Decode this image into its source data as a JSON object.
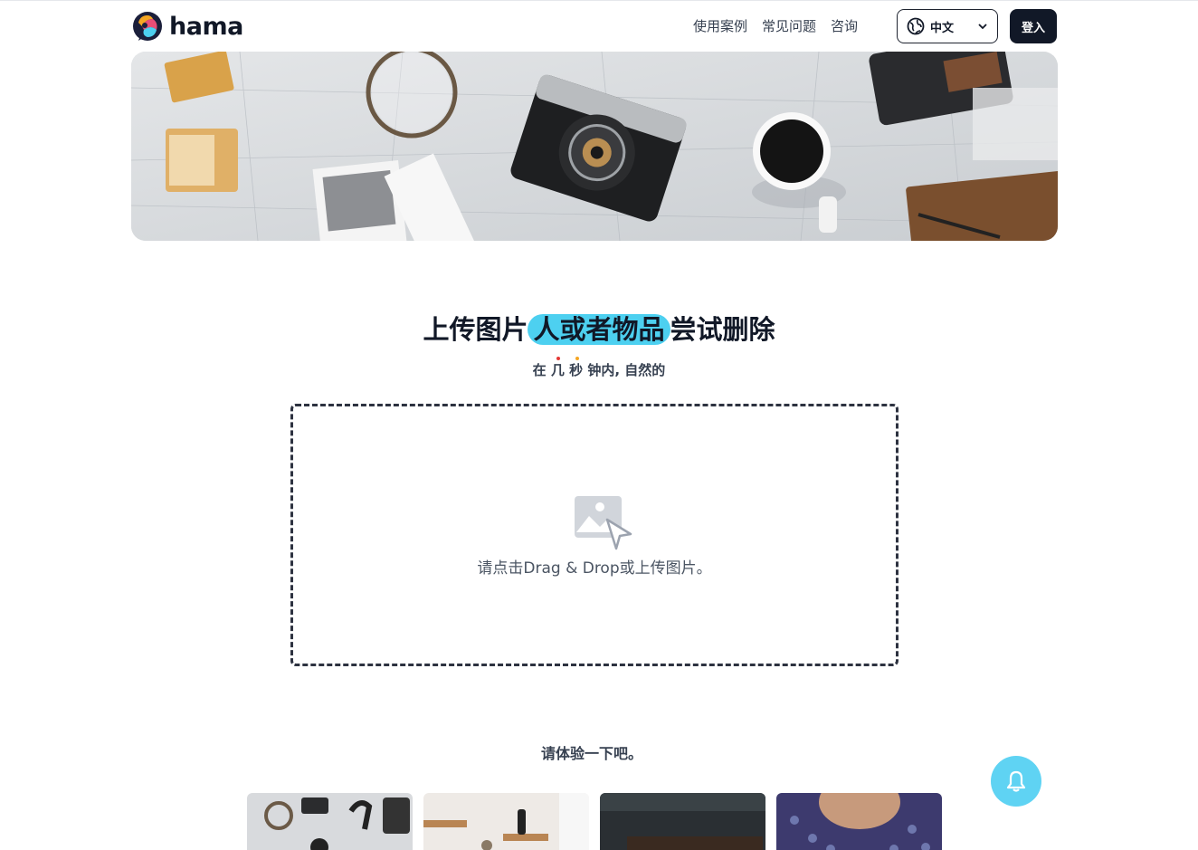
{
  "brand": {
    "name": "hama"
  },
  "nav": {
    "items": [
      {
        "label": "使用案例"
      },
      {
        "label": "常见问题"
      },
      {
        "label": "咨询"
      }
    ]
  },
  "language": {
    "selected": "中文",
    "icon": "globe-icon"
  },
  "login": {
    "label": "登入"
  },
  "hero": {
    "title_before": "上传图片",
    "title_highlight": "人或者物品",
    "title_after": "尝试删除",
    "highlight_color": "#4dd0f0",
    "subtitle_before": "在",
    "subtitle_emph": "几 秒",
    "subtitle_after": "钟内, 自然的"
  },
  "dropzone": {
    "text": "请点击Drag & Drop或上传图片。",
    "icon": "image-upload-icon"
  },
  "samples": {
    "title": "请体验一下吧。",
    "count_visible": 4
  },
  "notification": {
    "icon": "bell-icon",
    "color": "#5fd3f3"
  },
  "colors": {
    "primary": "#111827",
    "accent": "#4dd0f0"
  }
}
